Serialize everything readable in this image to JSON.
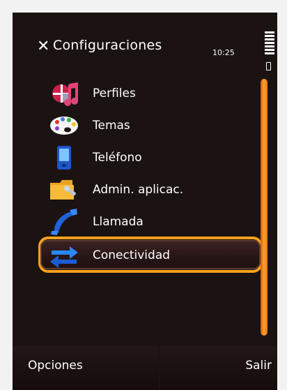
{
  "screen": {
    "title": "Configuraciones",
    "time": "10:25"
  },
  "menu": {
    "items": [
      {
        "label": "Perfiles",
        "icon": "profiles-icon"
      },
      {
        "label": "Temas",
        "icon": "themes-palette-icon"
      },
      {
        "label": "Teléfono",
        "icon": "phone-icon"
      },
      {
        "label": "Admin. aplicac.",
        "icon": "app-manager-folder-icon"
      },
      {
        "label": "Llamada",
        "icon": "call-handset-icon"
      },
      {
        "label": "Conectividad",
        "icon": "connectivity-arrows-icon",
        "selected": true
      }
    ]
  },
  "softkeys": {
    "left": "Opciones",
    "right": "Salir"
  },
  "colors": {
    "background": "#1b1212",
    "accent": "#f5a11c",
    "scrollbar": "#ff9f2e"
  }
}
